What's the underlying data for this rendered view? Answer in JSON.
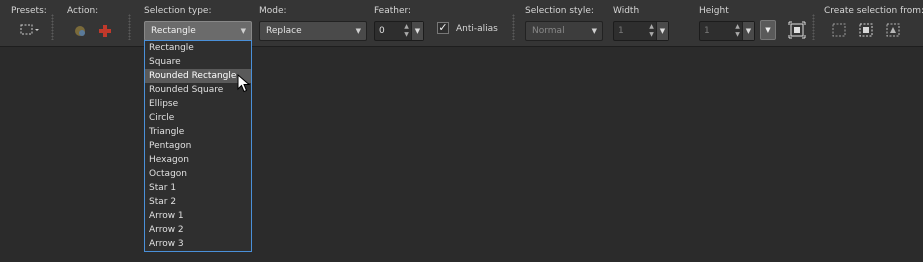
{
  "toolbar": {
    "presets_label": "Presets:",
    "action_label": "Action:",
    "selection_type_label": "Selection type:",
    "selection_type_value": "Rectangle",
    "mode_label": "Mode:",
    "mode_value": "Replace",
    "feather_label": "Feather:",
    "feather_value": "0",
    "anti_alias_label": "Anti-alias",
    "anti_alias_checked": true,
    "selection_style_label": "Selection style:",
    "selection_style_value": "Normal",
    "width_label": "Width",
    "width_value": "1",
    "height_label": "Height",
    "height_value": "1",
    "create_from_label": "Create selection from:"
  },
  "dropdown": {
    "options": [
      "Rectangle",
      "Square",
      "Rounded Rectangle",
      "Rounded Square",
      "Ellipse",
      "Circle",
      "Triangle",
      "Pentagon",
      "Hexagon",
      "Octagon",
      "Star 1",
      "Star 2",
      "Arrow 1",
      "Arrow 2",
      "Arrow 3"
    ],
    "highlighted": "Rounded Rectangle"
  },
  "colors": {
    "accent": "#4a90d9",
    "highlight": "#5a5a5a",
    "background": "#2b2b2b",
    "toolbar": "#353535"
  }
}
